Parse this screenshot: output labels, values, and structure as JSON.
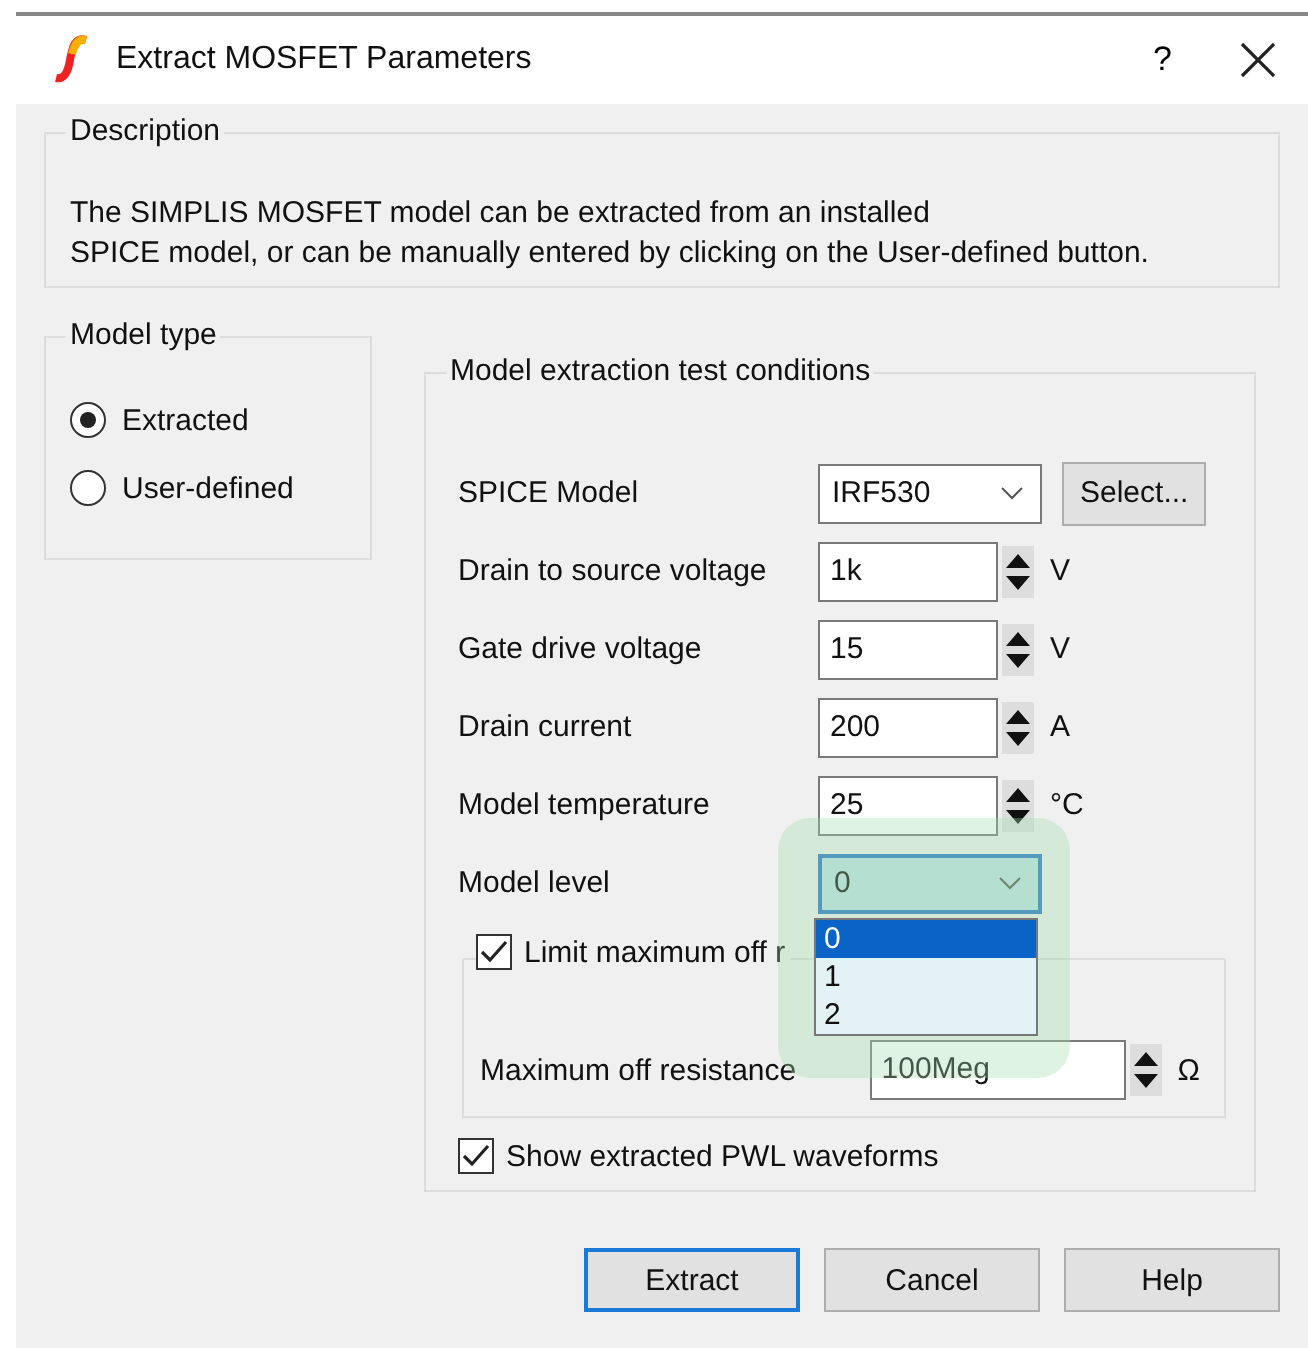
{
  "window": {
    "title": "Extract MOSFET Parameters",
    "help": "?"
  },
  "description": {
    "title": "Description",
    "text": "The SIMPLIS MOSFET model can be extracted from an installed\nSPICE model, or can be manually entered by clicking on the User-defined button."
  },
  "model_type": {
    "title": "Model type",
    "options": [
      {
        "label": "Extracted",
        "selected": true
      },
      {
        "label": "User-defined",
        "selected": false
      }
    ]
  },
  "conditions": {
    "title": "Model extraction test conditions",
    "spice_model": {
      "label": "SPICE Model",
      "value": "IRF530",
      "button": "Select..."
    },
    "fields": [
      {
        "label": "Drain to source voltage",
        "value": "1k",
        "unit": "V"
      },
      {
        "label": "Gate drive voltage",
        "value": "15",
        "unit": "V"
      },
      {
        "label": "Drain current",
        "value": "200",
        "unit": "A"
      },
      {
        "label": "Model temperature",
        "value": "25",
        "unit": "°C"
      }
    ],
    "model_level": {
      "label": "Model level",
      "value": "0",
      "options": [
        {
          "label": "0",
          "selected": true
        },
        {
          "label": "1",
          "selected": false
        },
        {
          "label": "2",
          "selected": false
        }
      ]
    },
    "limit": {
      "label": "Limit maximum off r",
      "checked": true,
      "field_label": "Maximum off resistance",
      "value": "100Meg",
      "unit": "Ω"
    },
    "show_waveforms": {
      "label": "Show extracted PWL waveforms",
      "checked": true
    }
  },
  "buttons": [
    {
      "label": "Extract",
      "default": true
    },
    {
      "label": "Cancel",
      "default": false
    },
    {
      "label": "Help",
      "default": false
    }
  ]
}
